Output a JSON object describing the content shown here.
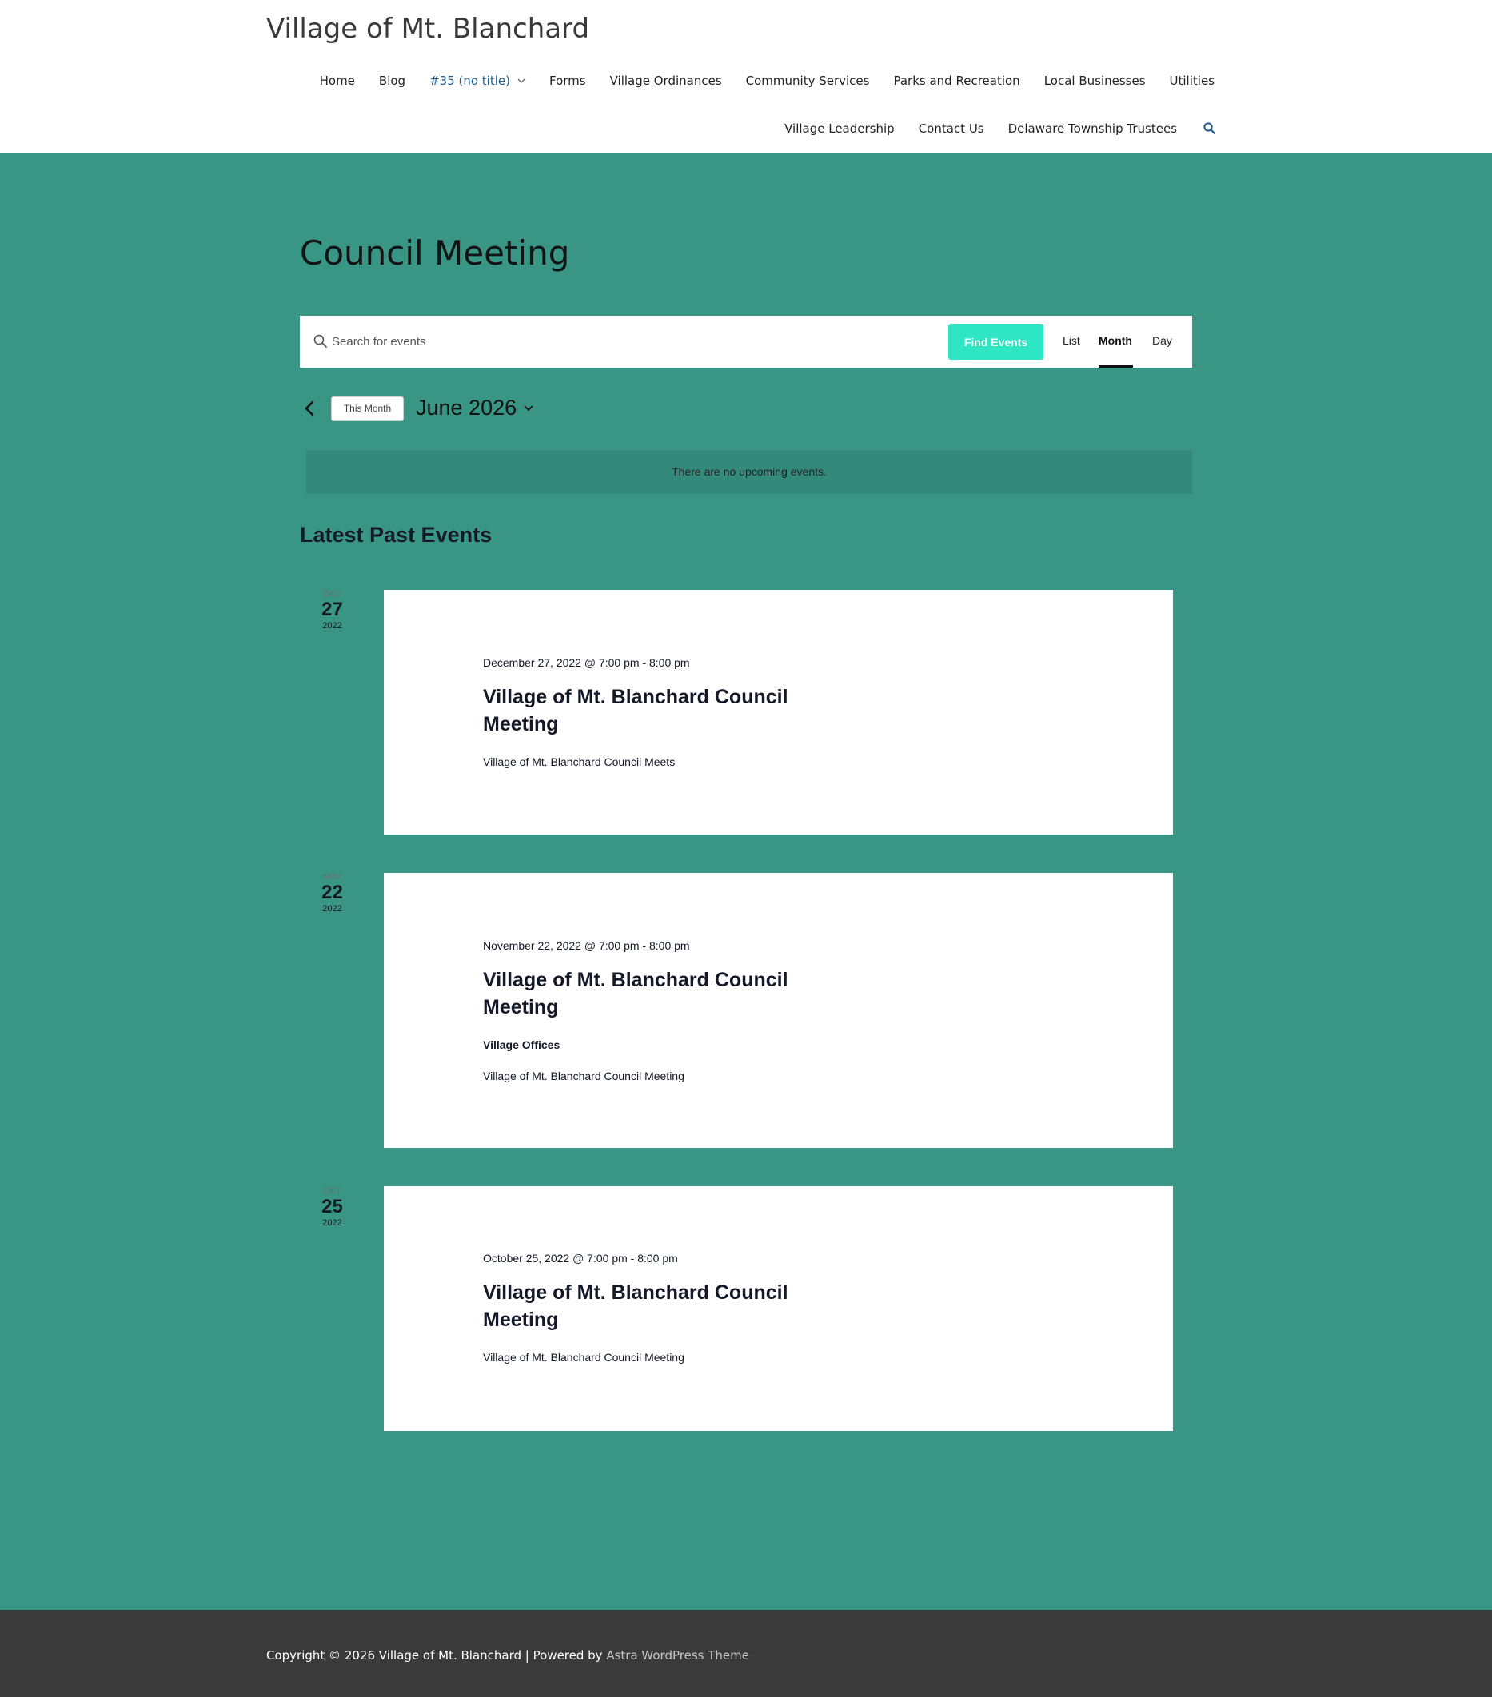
{
  "site": {
    "title": "Village of Mt. Blanchard"
  },
  "nav": {
    "row1": [
      "Home",
      "Blog",
      "#35 (no title)",
      "Forms",
      "Village Ordinances",
      "Community Services",
      "Parks and Recreation",
      "Local Businesses",
      "Utilities"
    ],
    "row2": [
      "Village Leadership",
      "Contact Us",
      "Delaware Township Trustees"
    ],
    "search_icon": "search-icon",
    "dropdown_icon": "chevron-down-icon"
  },
  "page": {
    "title": "Council Meeting"
  },
  "events_bar": {
    "search_placeholder": "Search for events",
    "find_button": "Find Events",
    "views": [
      "List",
      "Month",
      "Day"
    ],
    "active_view": "Month"
  },
  "month_nav": {
    "this_month": "This Month",
    "current": "June 2026"
  },
  "notice": "There are no upcoming events.",
  "past": {
    "heading": "Latest Past Events",
    "events": [
      {
        "mon": "Dec",
        "day": "27",
        "year": "2022",
        "datetime": "December 27, 2022 @ 7:00 pm - 8:00 pm",
        "title": "Village of Mt. Blanchard Council Meeting",
        "venue": "",
        "description": "Village of Mt. Blanchard Council Meets"
      },
      {
        "mon": "Nov",
        "day": "22",
        "year": "2022",
        "datetime": "November 22, 2022 @ 7:00 pm - 8:00 pm",
        "title": "Village of Mt. Blanchard Council Meeting",
        "venue": "Village Offices",
        "description": "Village of Mt. Blanchard Council Meeting"
      },
      {
        "mon": "Oct",
        "day": "25",
        "year": "2022",
        "datetime": "October 25, 2022 @ 7:00 pm - 8:00 pm",
        "title": "Village of Mt. Blanchard Council Meeting",
        "venue": "",
        "description": "Village of Mt. Blanchard Council Meeting"
      }
    ]
  },
  "footer": {
    "copyright": "Copyright © 2026 Village of Mt. Blanchard | Powered by ",
    "theme_link": "Astra WordPress Theme"
  },
  "colors": {
    "page_bg": "#3a9684",
    "find_button": "#2ee5c4",
    "footer_bg": "#3a3a3a",
    "active_nav": "#1f5c8a"
  }
}
